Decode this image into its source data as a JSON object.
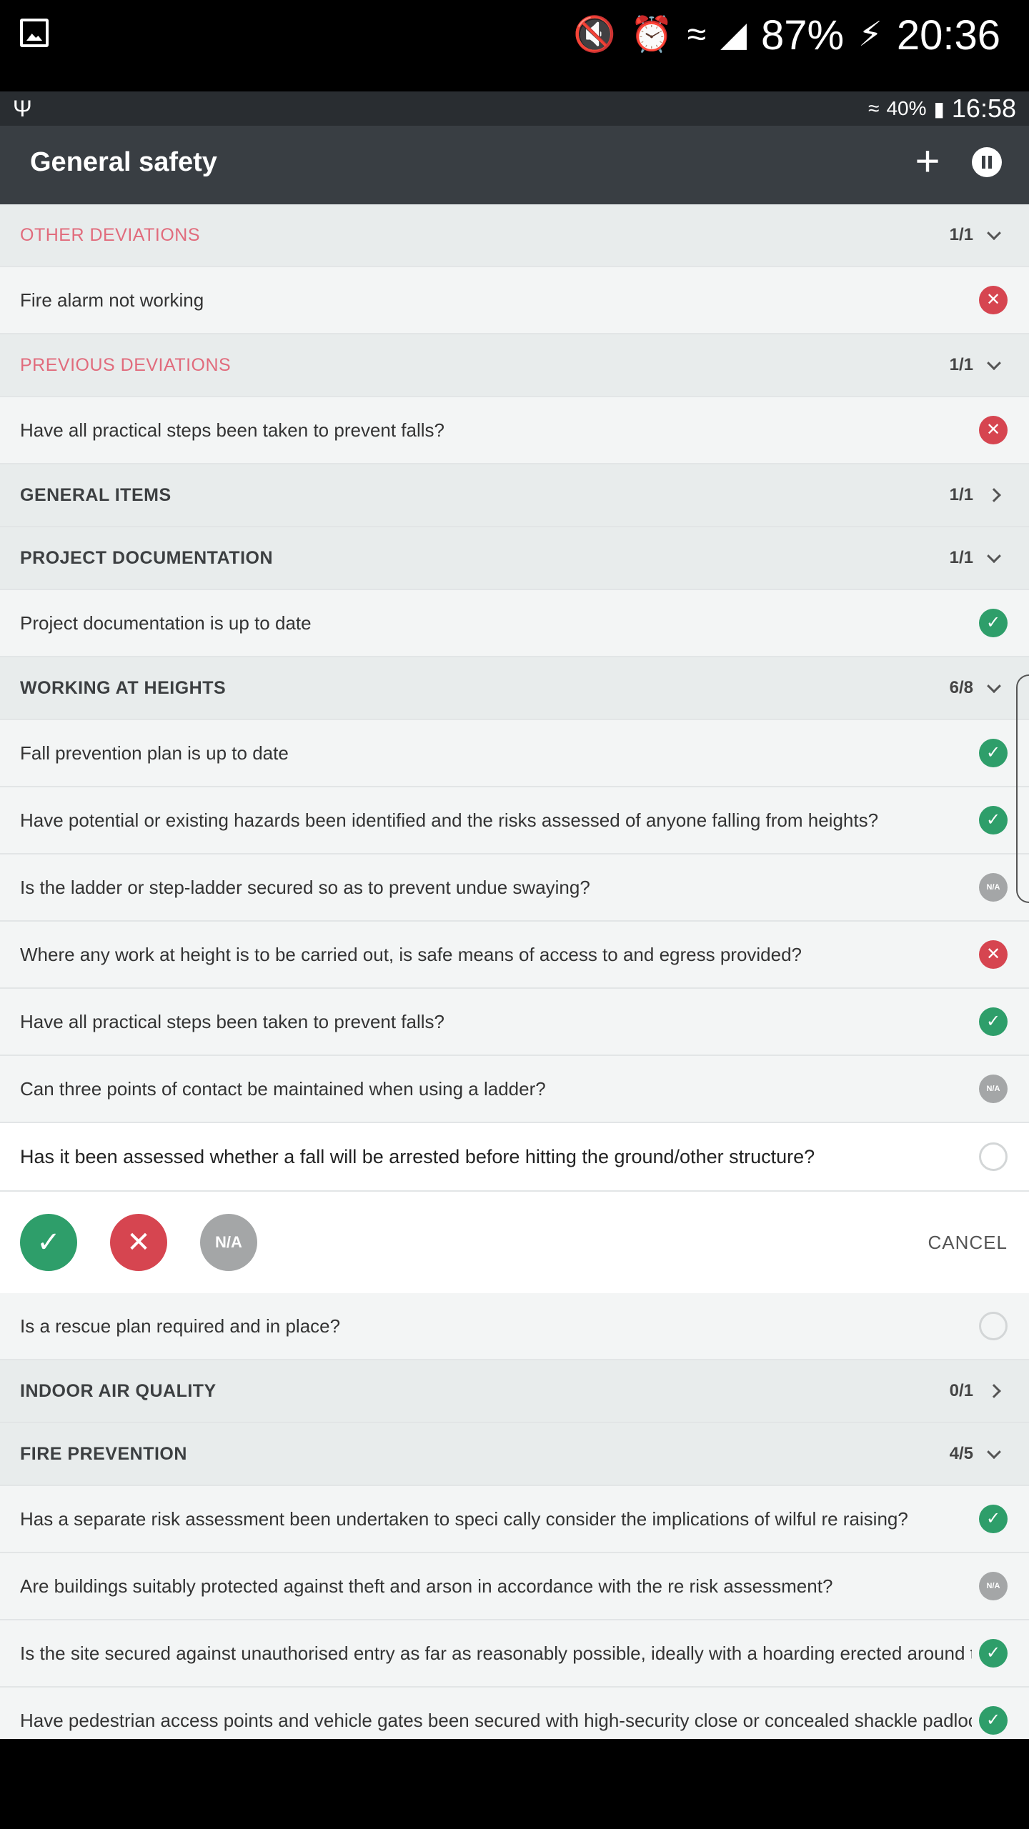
{
  "device_status": {
    "battery": "87%",
    "time": "20:36",
    "icons": [
      "gallery-icon",
      "mute-icon",
      "alarm-icon",
      "wifi-icon",
      "signal-icon",
      "battery-charging-icon"
    ]
  },
  "app_status": {
    "battery": "40%",
    "time": "16:58",
    "icons": [
      "usb-icon",
      "wifi-icon",
      "battery-icon"
    ]
  },
  "toolbar": {
    "title": "General safety",
    "add_icon": "+",
    "pause_icon": "pause-icon"
  },
  "colors": {
    "toolbar": "#393e43",
    "ok": "#2e9e6a",
    "bad": "#d64550",
    "na": "#a4a6a7",
    "alert_header": "#e16b7c"
  },
  "rows": [
    {
      "kind": "header",
      "label": "OTHER DEVIATIONS",
      "count": "1/1",
      "chevron": "down",
      "alert": true
    },
    {
      "kind": "item",
      "label": "Fire alarm not working",
      "status": "bad"
    },
    {
      "kind": "header",
      "label": "PREVIOUS DEVIATIONS",
      "count": "1/1",
      "chevron": "down",
      "alert": true
    },
    {
      "kind": "item",
      "label": "Have all practical steps been taken to prevent falls?",
      "status": "bad"
    },
    {
      "kind": "header",
      "label": "GENERAL ITEMS",
      "count": "1/1",
      "chevron": "right"
    },
    {
      "kind": "header",
      "label": "PROJECT DOCUMENTATION",
      "count": "1/1",
      "chevron": "down"
    },
    {
      "kind": "item",
      "label": "Project documentation is up to date",
      "status": "ok"
    },
    {
      "kind": "header",
      "label": "WORKING AT HEIGHTS",
      "count": "6/8",
      "chevron": "down"
    },
    {
      "kind": "item",
      "label": "Fall prevention plan is up to date",
      "status": "ok"
    },
    {
      "kind": "item",
      "label": "Have potential or existing hazards been identified and the risks assessed of anyone falling from heights?",
      "status": "ok"
    },
    {
      "kind": "item",
      "label": "Is the ladder or step-ladder secured so as to prevent undue swaying?",
      "status": "na"
    },
    {
      "kind": "item",
      "label": "Where any work at height is to be carried out, is safe means of access to and egress provided?",
      "status": "bad"
    },
    {
      "kind": "item",
      "label": "Have all practical steps been taken to prevent falls?",
      "status": "ok"
    },
    {
      "kind": "item",
      "label": "Can three points of contact be maintained when using a ladder?",
      "status": "na"
    },
    {
      "kind": "active",
      "label": "Has it been assessed whether a fall will be arrested before hitting the ground/other structure?",
      "status": "empty"
    },
    {
      "kind": "actions",
      "na_label": "N/A",
      "cancel_label": "CANCEL"
    },
    {
      "kind": "item",
      "label": "Is a rescue plan required and in place?",
      "status": "empty"
    },
    {
      "kind": "header",
      "label": "INDOOR AIR QUALITY",
      "count": "0/1",
      "chevron": "right"
    },
    {
      "kind": "header",
      "label": "FIRE PREVENTION",
      "count": "4/5",
      "chevron": "down"
    },
    {
      "kind": "item",
      "label": "Has a separate risk assessment been undertaken to speci cally consider the implications of wilful  re raising?",
      "status": "ok"
    },
    {
      "kind": "item",
      "label": "Are buildings suitably protected against theft and arson in accordance with the  re risk assessment?",
      "status": "na"
    },
    {
      "kind": "item",
      "label": "Is the site secured against unauthorised entry as far as reasonably possible, ideally with a hoarding erected around the perimeter?",
      "status": "ok"
    },
    {
      "kind": "item",
      "label": "Have pedestrian access points and vehicle gates been secured with high-security close or concealed shackle padlocks?",
      "status": "ok"
    }
  ],
  "na_badge": "N/A"
}
